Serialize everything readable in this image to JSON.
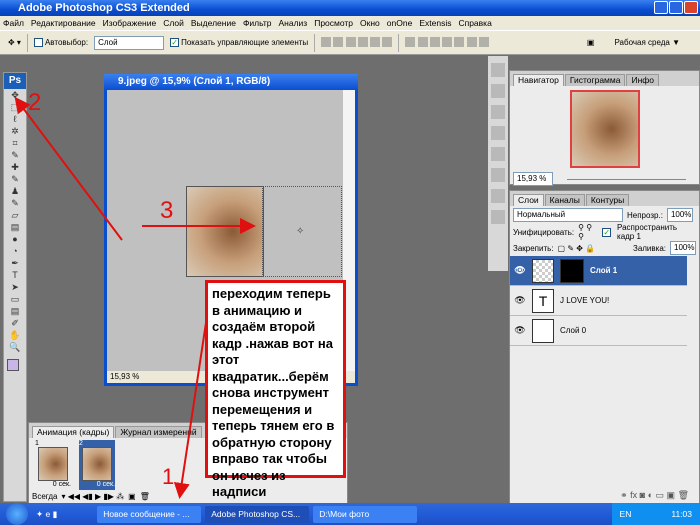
{
  "app": {
    "title": "Adobe Photoshop CS3 Extended"
  },
  "menu": [
    "Файл",
    "Редактирование",
    "Изображение",
    "Слой",
    "Выделение",
    "Фильтр",
    "Анализ",
    "Просмотр",
    "Окно",
    "onOne",
    "Extensis",
    "Справка"
  ],
  "options": {
    "autoselect_label": "Автовыбор:",
    "autoselect_value": "Слой",
    "show_controls_label": "Показать управляющие элементы",
    "workspace_label": "Рабочая среда ▼"
  },
  "toolbox": {
    "logo": "Ps",
    "tools": [
      "move",
      "marquee",
      "lasso",
      "magic-wand",
      "crop",
      "slice",
      "healing",
      "brush",
      "stamp",
      "history-brush",
      "eraser",
      "gradient",
      "blur",
      "dodge",
      "pen",
      "type",
      "path-select",
      "shape",
      "notes",
      "eyedropper",
      "hand",
      "zoom"
    ]
  },
  "document": {
    "title": "9.jpeg @ 15,9% (Слой 1, RGB/8)",
    "zoom": "15,93 %"
  },
  "callout": {
    "text": "переходим теперь в анимацию и создаём второй кадр .нажав вот на этот квадратик...берём снова инструмент перемещения и теперь тянем его в обратную сторону вправо так чтобы он исчез из надписи",
    "color": "#e01010"
  },
  "annotations": {
    "n1": "1",
    "n2": "2",
    "n3": "3"
  },
  "navigator": {
    "tabs": [
      "Навигатор",
      "Гистограмма",
      "Инфо"
    ],
    "zoom": "15,93 %"
  },
  "layers": {
    "tabs": [
      "Слои",
      "Каналы",
      "Контуры"
    ],
    "blend_mode": "Нормальный",
    "opacity_label": "Непрозр.:",
    "opacity": "100%",
    "unify_label": "Унифицировать:",
    "propagate_label": "Распространить кадр 1",
    "lock_label": "Закрепить:",
    "fill_label": "Заливка:",
    "fill": "100%",
    "items": [
      {
        "name": "Слой 1",
        "selected": true
      },
      {
        "name": "J LOVE YOU!",
        "type": "text"
      },
      {
        "name": "Слой 0"
      }
    ]
  },
  "animation": {
    "tabs": [
      "Анимация (кадры)",
      "Журнал измерений"
    ],
    "frames": [
      {
        "num": "1",
        "delay": "0 сек."
      },
      {
        "num": "2",
        "delay": "0 сек.",
        "selected": true
      }
    ],
    "loop": "Всегда"
  },
  "taskbar": {
    "tasks": [
      "Новое сообщение - ...",
      "Adobe Photoshop CS...",
      "D:\\Мои фото"
    ],
    "lang": "EN",
    "time": "11:03"
  }
}
